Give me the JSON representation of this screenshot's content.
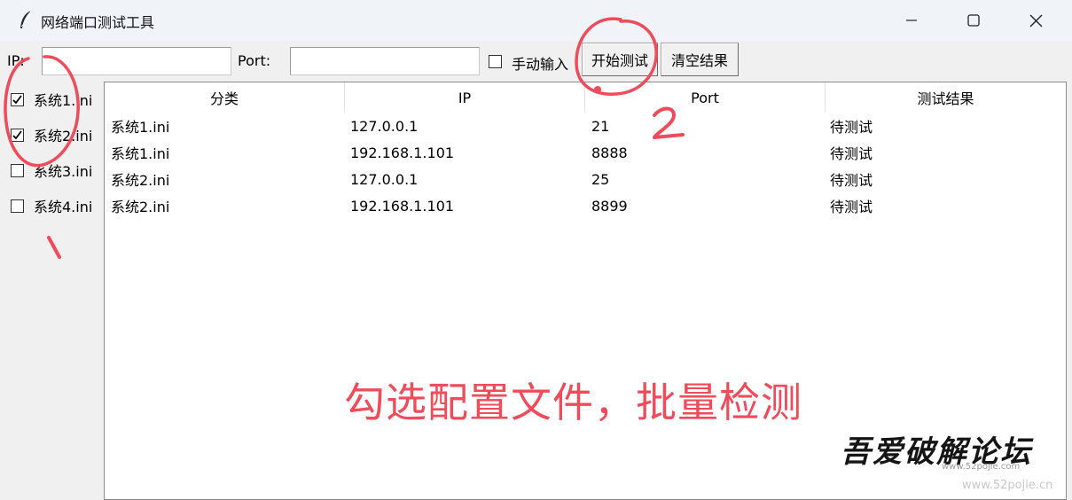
{
  "window": {
    "title": "网络端口测试工具",
    "icon": "feather-icon",
    "controls": [
      "minimize-icon",
      "maximize-icon",
      "close-icon"
    ]
  },
  "toolbar": {
    "ip_label": "IP:",
    "ip_value": "",
    "port_label": "Port:",
    "port_value": "",
    "manual_input_label": "手动输入",
    "manual_input_checked": false,
    "start_button": "开始测试",
    "clear_button": "清空结果"
  },
  "configs": [
    {
      "label": "系统1.ini",
      "checked": true
    },
    {
      "label": "系统2.ini",
      "checked": true
    },
    {
      "label": "系统3.ini",
      "checked": false
    },
    {
      "label": "系统4.ini",
      "checked": false
    }
  ],
  "table": {
    "columns": [
      "分类",
      "IP",
      "Port",
      "测试结果"
    ],
    "rows": [
      [
        "系统1.ini",
        "127.0.0.1",
        "21",
        "待测试"
      ],
      [
        "系统1.ini",
        "192.168.1.101",
        "8888",
        "待测试"
      ],
      [
        "系统2.ini",
        "127.0.0.1",
        "25",
        "待测试"
      ],
      [
        "系统2.ini",
        "192.168.1.101",
        "8899",
        "待测试"
      ]
    ]
  },
  "annotations": {
    "step1": "1",
    "step2": "2",
    "caption": "勾选配置文件，批量检测",
    "color": "#ef4b5b"
  },
  "watermark": {
    "title": "吾爱破解论坛",
    "url": "www.52pojie.cn"
  }
}
